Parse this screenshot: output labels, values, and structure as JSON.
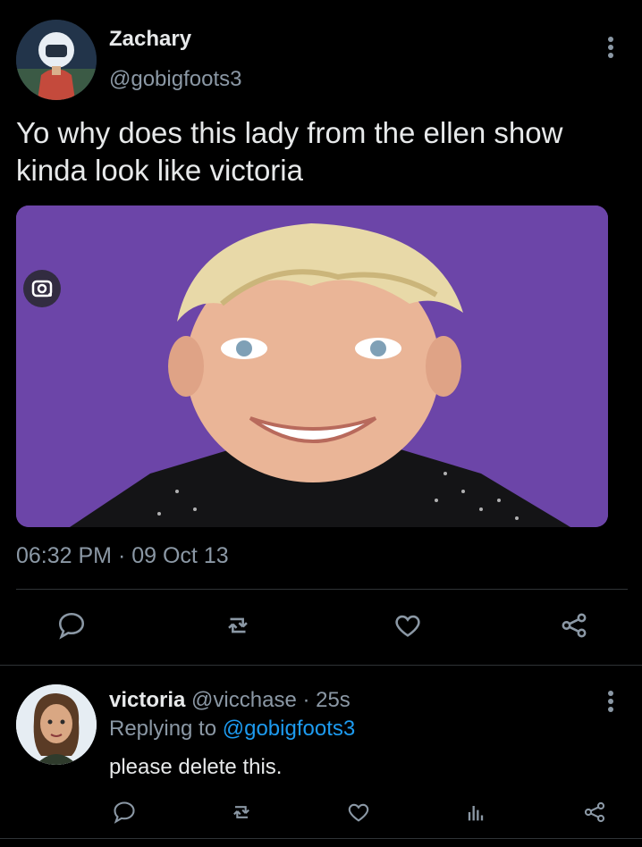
{
  "tweet": {
    "author_name": "Zachary",
    "author_handle": "@gobigfoots3",
    "text": "Yo why does this lady from the ellen show kinda look like victoria",
    "timestamp": "06:32 PM · 09 Oct 13",
    "media_icon": "lens-icon",
    "actions": [
      "reply-icon",
      "retweet-icon",
      "like-icon",
      "share-icon"
    ]
  },
  "reply": {
    "author_name": "victoria",
    "author_meta": "@vicchase · 25s",
    "replying_prefix": "Replying to",
    "replying_to": "@gobigfoots3",
    "text": "please delete this.",
    "actions": [
      "reply-icon",
      "retweet-icon",
      "like-icon",
      "views-icon",
      "share-icon"
    ]
  },
  "colors": {
    "background": "#000000",
    "text": "#e7e9ea",
    "muted": "#8b98a5",
    "link": "#1d9bf0",
    "media_backdrop": "#6c45a8"
  }
}
